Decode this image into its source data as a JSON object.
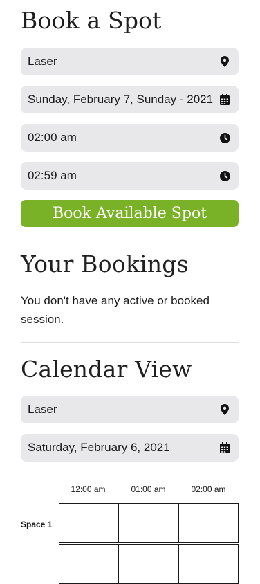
{
  "book": {
    "title": "Book a Spot",
    "location": "Laser",
    "date": "Sunday, February 7, Sunday - 2021",
    "start_time": "02:00 am",
    "end_time": "02:59 am",
    "submit_label": "Book Available Spot",
    "accent_color": "#79b127"
  },
  "bookings": {
    "title": "Your Bookings",
    "empty_message": "You don't have any active or booked session."
  },
  "calendar": {
    "title": "Calendar View",
    "location": "Laser",
    "date": "Saturday, February 6, 2021",
    "columns": [
      "12:00 am",
      "01:00 am",
      "02:00 am"
    ],
    "rows": [
      {
        "label": "Space 1"
      }
    ]
  },
  "icons": {
    "location": "map-pin-icon",
    "date": "calendar-icon",
    "time": "clock-icon"
  }
}
